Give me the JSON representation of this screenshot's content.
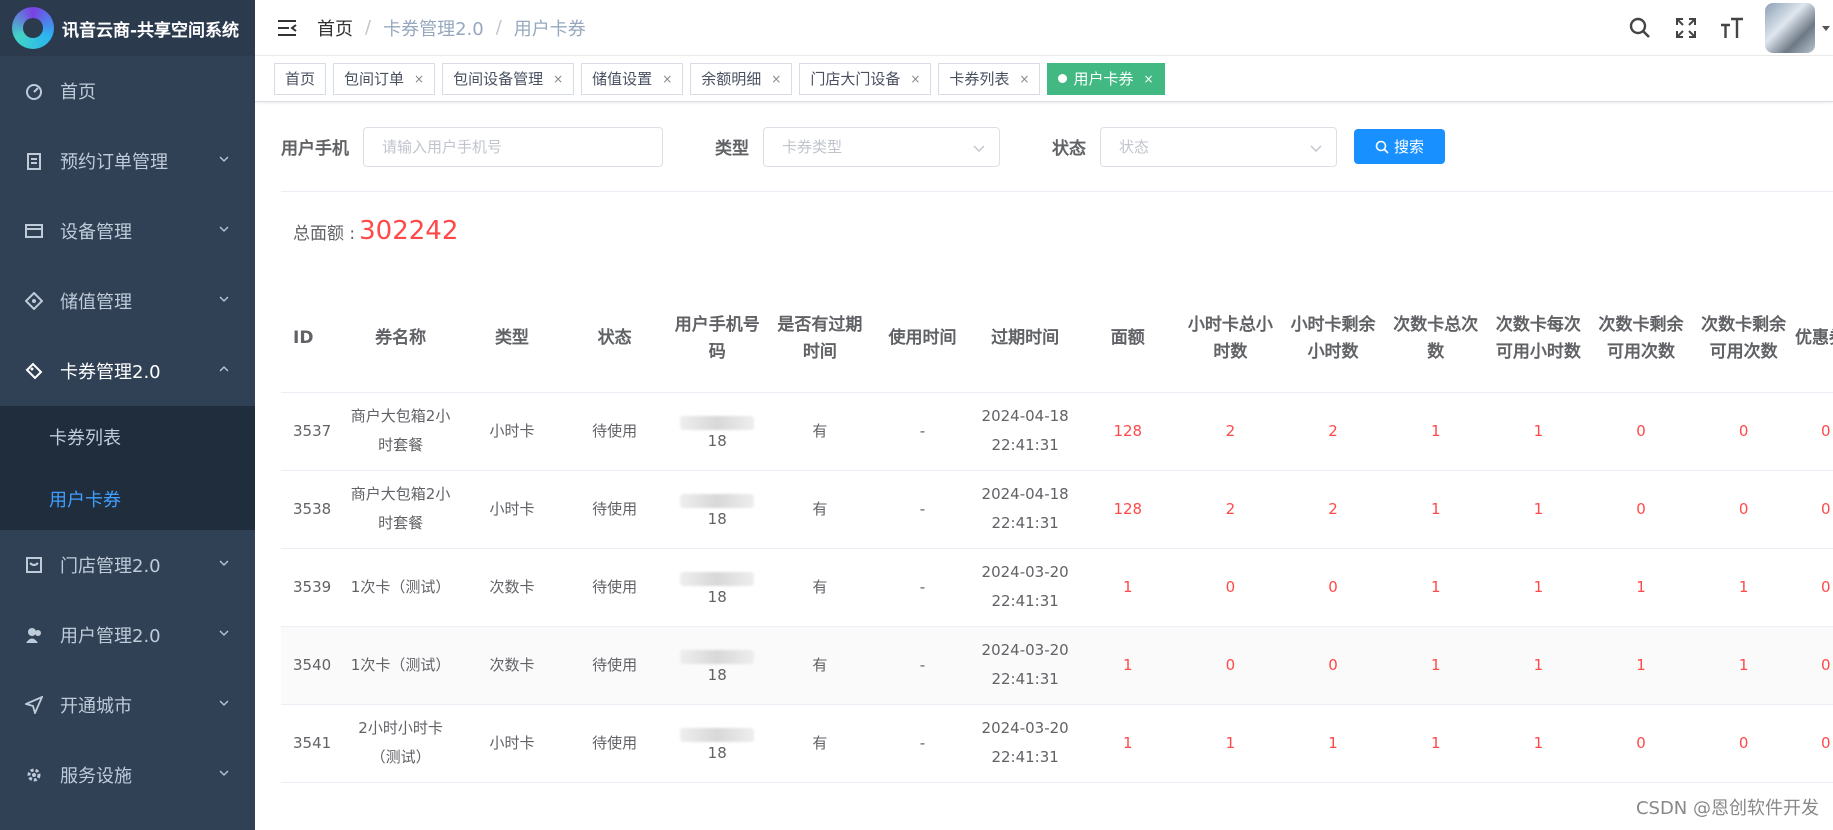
{
  "app": {
    "title": "讯音云商-共享空间系统"
  },
  "sidebar": {
    "items": [
      {
        "label": "首页",
        "icon": "dashboard-icon"
      },
      {
        "label": "预约订单管理",
        "icon": "clipboard-icon"
      },
      {
        "label": "设备管理",
        "icon": "device-icon"
      },
      {
        "label": "储值管理",
        "icon": "wallet-icon"
      },
      {
        "label": "卡券管理2.0",
        "icon": "coupon-icon",
        "open": true,
        "children": [
          {
            "label": "卡券列表"
          },
          {
            "label": "用户卡券",
            "active": true
          }
        ]
      },
      {
        "label": "门店管理2.0",
        "icon": "store-icon"
      },
      {
        "label": "用户管理2.0",
        "icon": "user-icon"
      },
      {
        "label": "开通城市",
        "icon": "send-icon"
      },
      {
        "label": "服务设施",
        "icon": "gear-icon"
      }
    ]
  },
  "header": {
    "breadcrumb": [
      "首页",
      "卡券管理2.0",
      "用户卡券"
    ],
    "breadcrumb_sep": "/"
  },
  "tags": [
    {
      "label": "首页",
      "closable": false
    },
    {
      "label": "包间订单",
      "closable": true
    },
    {
      "label": "包间设备管理",
      "closable": true
    },
    {
      "label": "储值设置",
      "closable": true
    },
    {
      "label": "余额明细",
      "closable": true
    },
    {
      "label": "门店大门设备",
      "closable": true
    },
    {
      "label": "卡券列表",
      "closable": true
    },
    {
      "label": "用户卡券",
      "closable": true,
      "active": true
    }
  ],
  "tag_close": "×",
  "filters": {
    "phone_label": "用户手机",
    "phone_placeholder": "请输入用户手机号",
    "type_label": "类型",
    "type_placeholder": "卡券类型",
    "status_label": "状态",
    "status_placeholder": "状态",
    "search_label": "搜索"
  },
  "summary": {
    "label": "总面额 :",
    "value": "302242"
  },
  "table": {
    "columns": [
      "ID",
      "券名称",
      "类型",
      "状态",
      "用户手机号码",
      "是否有过期时间",
      "使用时间",
      "过期时间",
      "面额",
      "小时卡总小时数",
      "小时卡剩余小时数",
      "次数卡总次数",
      "次数卡每次可用小时数",
      "次数卡剩余可用次数",
      "次数卡剩余可用次数",
      "优惠券满多少可用"
    ],
    "rows": [
      [
        "3537",
        "商户大包箱2小时套餐",
        "小时卡",
        "待使用",
        "18",
        "有",
        "-",
        "2024-04-18 22:41:31",
        "128",
        "2",
        "2",
        "1",
        "1",
        "0",
        "0",
        "0"
      ],
      [
        "3538",
        "商户大包箱2小时套餐",
        "小时卡",
        "待使用",
        "18",
        "有",
        "-",
        "2024-04-18 22:41:31",
        "128",
        "2",
        "2",
        "1",
        "1",
        "0",
        "0",
        "0"
      ],
      [
        "3539",
        "1次卡（测试）",
        "次数卡",
        "待使用",
        "18",
        "有",
        "-",
        "2024-03-20 22:41:31",
        "1",
        "0",
        "0",
        "1",
        "1",
        "1",
        "1",
        "0"
      ],
      [
        "3540",
        "1次卡（测试）",
        "次数卡",
        "待使用",
        "18",
        "有",
        "-",
        "2024-03-20 22:41:31",
        "1",
        "0",
        "0",
        "1",
        "1",
        "1",
        "1",
        "0"
      ],
      [
        "3541",
        "2小时小时卡（测试）",
        "小时卡",
        "待使用",
        "18",
        "有",
        "-",
        "2024-03-20 22:41:31",
        "1",
        "1",
        "1",
        "1",
        "1",
        "0",
        "0",
        "0"
      ]
    ]
  },
  "watermark": "CSDN @恩创软件开发",
  "colors": {
    "sidebar": "#304156",
    "active_tag": "#42b983",
    "accent": "#1890ff",
    "danger": "#ff4949"
  }
}
